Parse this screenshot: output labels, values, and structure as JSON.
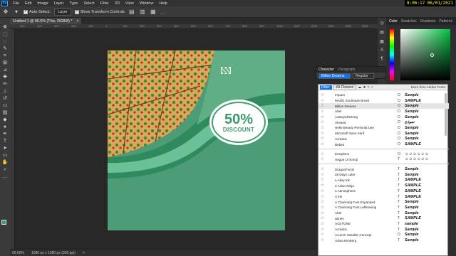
{
  "menubar": {
    "logo": "Ps",
    "items": [
      "File",
      "Edit",
      "Image",
      "Layer",
      "Type",
      "Select",
      "Filter",
      "3D",
      "View",
      "Window",
      "Help"
    ]
  },
  "clock": "8:06:17  06/01/2021",
  "options": {
    "auto_select_label": "Auto-Select:",
    "auto_select_value": "Layer",
    "show_transform_label": "Show Transform Controls",
    "more": "…"
  },
  "document": {
    "tab_label": "Untitled-1 @ 66.6% (This, RGB/8) *",
    "close": "×"
  },
  "ruler_top": [
    "500",
    "400",
    "300",
    "200",
    "100",
    "0",
    "100",
    "200",
    "300",
    "400",
    "500",
    "600",
    "700",
    "800",
    "900",
    "1000",
    "1100",
    "1200",
    "1300",
    "1400",
    "1500",
    "1600"
  ],
  "artwork": {
    "badge_percent": "50%",
    "badge_text": "DISCOUNT"
  },
  "status": {
    "zoom": "66.66%",
    "doc_info": "1080 px x 1080 px (300 ppi)",
    "arrow": ">"
  },
  "color_panel": {
    "tabs": [
      "Color",
      "Swatches",
      "Gradients",
      "Patterns"
    ]
  },
  "character_panel": {
    "tabs": [
      "Character",
      "Paragraph"
    ],
    "font_family": "Billion Dreams",
    "font_style": "Regular"
  },
  "font_list": {
    "filter_label": "Filter:",
    "filter_value": "All Classes",
    "adobe_label": "More from Adobe Fonts:",
    "group1": [
      {
        "name": "Impact",
        "type": "O",
        "sample": "Sample"
      },
      {
        "name": "MADE Soulmaze Brush",
        "type": "O",
        "sample": "SAMPLE"
      },
      {
        "name": "Billion Dreams",
        "type": "O",
        "sample": "Sample"
      },
      {
        "name": "Abel",
        "type": "O",
        "sample": "Sample"
      },
      {
        "name": "Aaleeyahstrong",
        "type": "O",
        "sample": "Sample"
      },
      {
        "name": "Almarai",
        "type": "O",
        "sample": "نموذج"
      },
      {
        "name": "Hello Beauty Personal Use",
        "type": "O",
        "sample": "Sample"
      },
      {
        "name": "Microsoft Sans Serif",
        "type": "O",
        "sample": "Sample"
      },
      {
        "name": "Acratica",
        "type": "O",
        "sample": "Sample"
      },
      {
        "name": "Bebas",
        "type": "O",
        "sample": "SAMPLE"
      }
    ],
    "group2": [
      {
        "name": "EmojiOne",
        "type": "O",
        "sample": "☺☺☺☺☺☺"
      },
      {
        "name": "Segoe UI Emoji",
        "type": "T",
        "sample": "☺☺☺☺☺☺"
      }
    ],
    "group3": [
      {
        "name": "DragonForcE",
        "type": "T",
        "sample": "Sample"
      },
      {
        "name": "28 Days Later",
        "type": "T",
        "sample": "Sample"
      },
      {
        "name": "a Alloy Ink",
        "type": "T",
        "sample": "SAMPLE"
      },
      {
        "name": "a Asian Ninja",
        "type": "T",
        "sample": "SAMPLE"
      },
      {
        "name": "a Atmospheric",
        "type": "T",
        "sample": "SAMPLE"
      },
      {
        "name": "A Ink",
        "type": "T",
        "sample": "SAMPLE"
      },
      {
        "name": "A Charming Font Expanded",
        "type": "T",
        "sample": "Sample"
      },
      {
        "name": "A Charming Font Leftleaning",
        "type": "T",
        "sample": "Sample"
      },
      {
        "name": "Abel",
        "type": "T",
        "sample": "Sample"
      },
      {
        "name": "abnes",
        "type": "T",
        "sample": "SAMPLE"
      },
      {
        "name": "ACETONE",
        "type": "T",
        "sample": "sample"
      },
      {
        "name": "Acratica",
        "type": "T",
        "sample": "Sample"
      },
      {
        "name": "Acumin Variable Concept",
        "type": "O",
        "sample": "Sample"
      },
      {
        "name": "Adina Kimberg",
        "type": "T",
        "sample": "Sample"
      }
    ]
  }
}
